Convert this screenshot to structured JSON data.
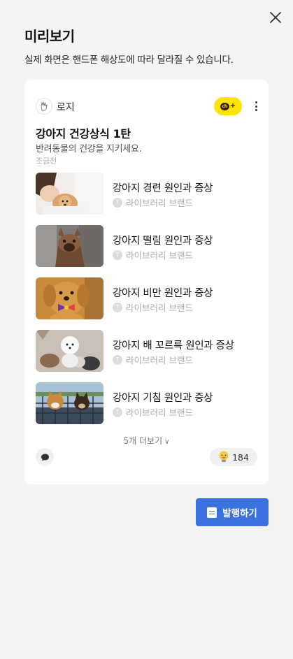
{
  "dialog": {
    "title": "미리보기",
    "subtitle": "실제 화면은 핸드폰 해상도에 따라 달라질 수 있습니다."
  },
  "card": {
    "profile_name": "로지",
    "chat_badge_text": "ch",
    "post_title": "강아지 건강상식 1탄",
    "post_description": "반려동물의 건강을 지키세요.",
    "post_time": "조금전",
    "items": [
      {
        "title": "강아지 경련 원인과 증상",
        "brand": "라이브러리 브랜드",
        "thumb_icon": "puppy-held-photo"
      },
      {
        "title": "강아지 떨림 원인과 증상",
        "brand": "라이브러리 브랜드",
        "thumb_icon": "french-bulldog-photo"
      },
      {
        "title": "강아지 비만 원인과 증상",
        "brand": "라이브러리 브랜드",
        "thumb_icon": "puppy-bowtie-photo"
      },
      {
        "title": "강아지 배 꼬르륵 원인과 증상",
        "brand": "라이브러리 브랜드",
        "thumb_icon": "pomeranian-photo"
      },
      {
        "title": "강아지 기침 원인과 증상",
        "brand": "라이브러리 브랜드",
        "thumb_icon": "shiba-dogs-photo"
      }
    ],
    "more_label": "5개 더보기",
    "like_count": "184"
  },
  "actions": {
    "publish_label": "발행하기"
  },
  "colors": {
    "primary": "#3b72e0",
    "kakao_yellow": "#fee500",
    "background": "#f4f4f4"
  }
}
